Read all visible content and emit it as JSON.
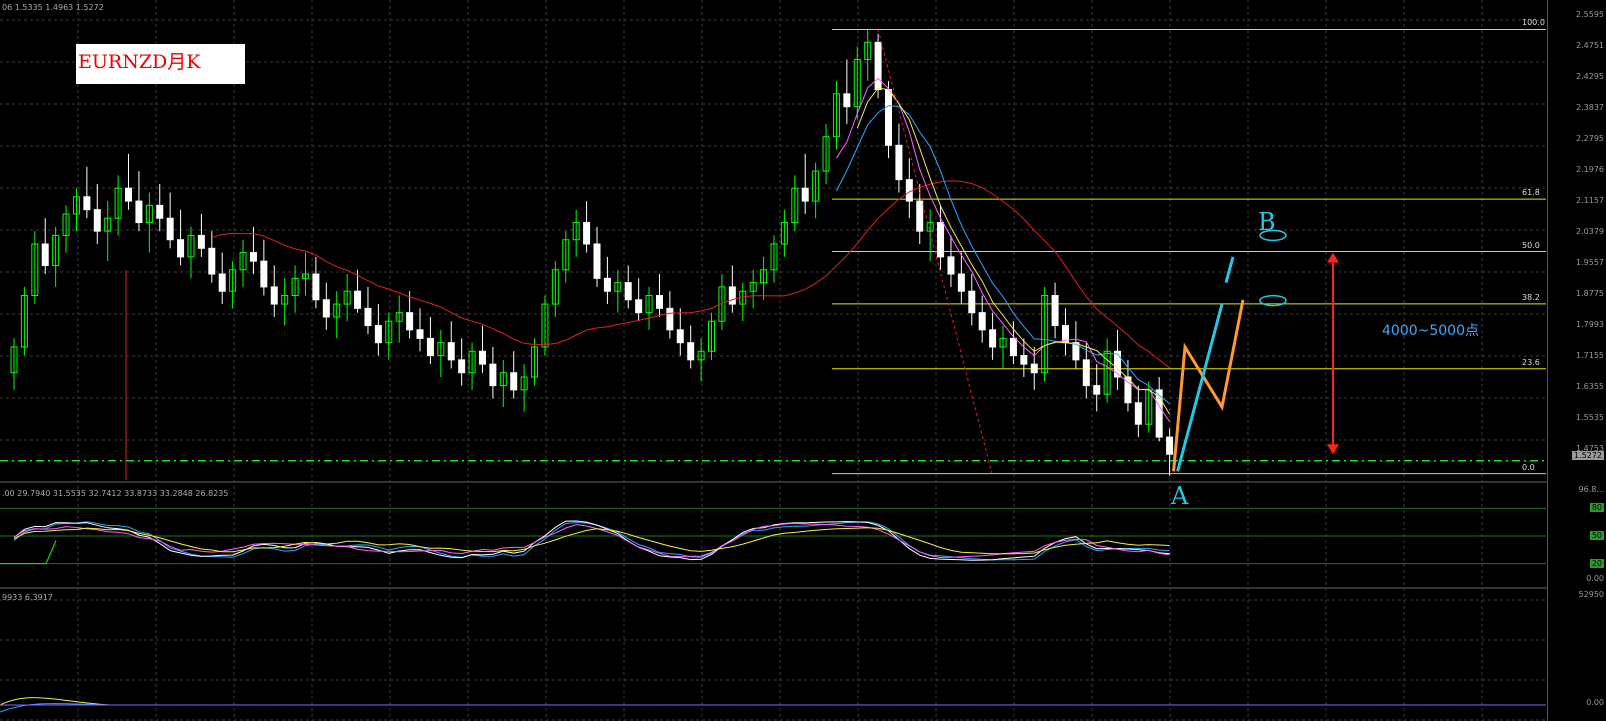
{
  "title": "EURNZD月K",
  "header_info": {
    "main": "06 1.5335 1.4963 1.5272",
    "stoch": ".00 29.7940 31.5535 32.7412 33.8733 33.2848 26.8235",
    "volume": "9933 6.3917"
  },
  "annotations": {
    "point_a": "A",
    "point_b": "B",
    "range_text": "4000~5000点"
  },
  "fib_levels": [
    {
      "label": "100.0",
      "value": 100.0
    },
    {
      "label": "61.8",
      "value": 61.8
    },
    {
      "label": "50.0",
      "value": 50.0
    },
    {
      "label": "38.2",
      "value": 38.2
    },
    {
      "label": "23.6",
      "value": 23.6
    },
    {
      "label": "0.0",
      "value": 0.0
    }
  ],
  "price_axis_labels": [
    "2.5595",
    "2.4751",
    "2.4295",
    "2.3837",
    "2.2795",
    "2.1976",
    "2.1157",
    "2.0379",
    "1.9557",
    "1.8775",
    "1.7993",
    "1.7155",
    "1.6355",
    "1.5535",
    "1.4753"
  ],
  "current_price": "1.5272",
  "oscillator_axis_labels": [
    "96.8...",
    "80",
    "50",
    "20",
    "0.00"
  ],
  "oscillator_levels": [
    80,
    50,
    20
  ],
  "volume_axis_labels": [
    "52950",
    "0.00"
  ],
  "colors": {
    "bull": "#00ff00",
    "bear": "#ffffff",
    "fib_line": "#e6e600",
    "dashed_level": "#20e020",
    "ma_red": "#e02020",
    "ma_pink": "#ff60ff",
    "ma_blue": "#2aa8ff",
    "ma_yellow": "#f0f040",
    "projection_orange": "#ff9933",
    "projection_cyan": "#22c8e6",
    "arrow_red": "#ff2020"
  },
  "chart_data": {
    "type": "candlestick",
    "title": "EURNZD月K",
    "y_range": [
      1.47,
      2.57
    ],
    "fib_high": 2.52,
    "fib_low": 1.485,
    "dashed_level_price": 1.515,
    "candles": [
      [
        1.72,
        1.8,
        1.68,
        1.78
      ],
      [
        1.78,
        1.92,
        1.76,
        1.9
      ],
      [
        1.9,
        2.05,
        1.88,
        2.02
      ],
      [
        2.02,
        2.08,
        1.95,
        1.97
      ],
      [
        1.97,
        2.06,
        1.92,
        2.04
      ],
      [
        2.04,
        2.11,
        2.0,
        2.09
      ],
      [
        2.09,
        2.15,
        2.05,
        2.13
      ],
      [
        2.13,
        2.2,
        2.08,
        2.1
      ],
      [
        2.1,
        2.16,
        2.02,
        2.05
      ],
      [
        2.05,
        2.12,
        1.98,
        2.08
      ],
      [
        2.08,
        2.18,
        2.04,
        2.15
      ],
      [
        2.15,
        2.23,
        2.1,
        2.12
      ],
      [
        2.12,
        2.19,
        2.05,
        2.07
      ],
      [
        2.07,
        2.14,
        2.0,
        2.11
      ],
      [
        2.11,
        2.16,
        2.05,
        2.08
      ],
      [
        2.08,
        2.14,
        2.01,
        2.03
      ],
      [
        2.03,
        2.1,
        1.97,
        1.99
      ],
      [
        1.99,
        2.06,
        1.94,
        2.04
      ],
      [
        2.04,
        2.09,
        1.99,
        2.01
      ],
      [
        2.01,
        2.05,
        1.93,
        1.95
      ],
      [
        1.95,
        2.0,
        1.88,
        1.91
      ],
      [
        1.91,
        1.98,
        1.87,
        1.96
      ],
      [
        1.96,
        2.03,
        1.92,
        2.0
      ],
      [
        2.0,
        2.06,
        1.95,
        1.98
      ],
      [
        1.98,
        2.03,
        1.9,
        1.92
      ],
      [
        1.92,
        1.97,
        1.85,
        1.88
      ],
      [
        1.88,
        1.94,
        1.83,
        1.9
      ],
      [
        1.9,
        1.97,
        1.86,
        1.94
      ],
      [
        1.94,
        2.0,
        1.9,
        1.95
      ],
      [
        1.95,
        1.99,
        1.87,
        1.89
      ],
      [
        1.89,
        1.93,
        1.82,
        1.85
      ],
      [
        1.85,
        1.91,
        1.8,
        1.88
      ],
      [
        1.88,
        1.95,
        1.84,
        1.91
      ],
      [
        1.91,
        1.96,
        1.86,
        1.87
      ],
      [
        1.87,
        1.92,
        1.81,
        1.83
      ],
      [
        1.83,
        1.88,
        1.76,
        1.79
      ],
      [
        1.79,
        1.86,
        1.75,
        1.84
      ],
      [
        1.84,
        1.9,
        1.79,
        1.86
      ],
      [
        1.86,
        1.91,
        1.8,
        1.82
      ],
      [
        1.82,
        1.87,
        1.77,
        1.8
      ],
      [
        1.8,
        1.85,
        1.74,
        1.76
      ],
      [
        1.76,
        1.82,
        1.71,
        1.79
      ],
      [
        1.79,
        1.84,
        1.73,
        1.75
      ],
      [
        1.75,
        1.8,
        1.69,
        1.72
      ],
      [
        1.72,
        1.79,
        1.68,
        1.77
      ],
      [
        1.77,
        1.83,
        1.72,
        1.74
      ],
      [
        1.74,
        1.78,
        1.66,
        1.69
      ],
      [
        1.69,
        1.75,
        1.64,
        1.72
      ],
      [
        1.72,
        1.77,
        1.66,
        1.68
      ],
      [
        1.68,
        1.74,
        1.63,
        1.71
      ],
      [
        1.71,
        1.8,
        1.69,
        1.78
      ],
      [
        1.78,
        1.9,
        1.76,
        1.88
      ],
      [
        1.88,
        1.98,
        1.85,
        1.96
      ],
      [
        1.96,
        2.05,
        1.93,
        2.03
      ],
      [
        2.03,
        2.1,
        1.99,
        2.07
      ],
      [
        2.07,
        2.12,
        2.0,
        2.02
      ],
      [
        2.02,
        2.06,
        1.92,
        1.94
      ],
      [
        1.94,
        1.99,
        1.88,
        1.91
      ],
      [
        1.91,
        1.96,
        1.86,
        1.93
      ],
      [
        1.93,
        1.97,
        1.87,
        1.89
      ],
      [
        1.89,
        1.94,
        1.84,
        1.86
      ],
      [
        1.86,
        1.92,
        1.82,
        1.9
      ],
      [
        1.9,
        1.95,
        1.85,
        1.87
      ],
      [
        1.87,
        1.91,
        1.8,
        1.82
      ],
      [
        1.82,
        1.87,
        1.76,
        1.79
      ],
      [
        1.79,
        1.83,
        1.73,
        1.75
      ],
      [
        1.75,
        1.8,
        1.7,
        1.77
      ],
      [
        1.77,
        1.86,
        1.75,
        1.84
      ],
      [
        1.84,
        1.95,
        1.82,
        1.92
      ],
      [
        1.92,
        1.97,
        1.86,
        1.88
      ],
      [
        1.88,
        1.93,
        1.84,
        1.91
      ],
      [
        1.91,
        1.96,
        1.87,
        1.93
      ],
      [
        1.93,
        1.99,
        1.89,
        1.96
      ],
      [
        1.96,
        2.04,
        1.93,
        2.02
      ],
      [
        2.02,
        2.1,
        1.99,
        2.07
      ],
      [
        2.07,
        2.18,
        2.05,
        2.15
      ],
      [
        2.15,
        2.23,
        2.09,
        2.12
      ],
      [
        2.12,
        2.21,
        2.08,
        2.19
      ],
      [
        2.19,
        2.3,
        2.16,
        2.27
      ],
      [
        2.27,
        2.4,
        2.24,
        2.37
      ],
      [
        2.37,
        2.45,
        2.3,
        2.34
      ],
      [
        2.34,
        2.48,
        2.31,
        2.45
      ],
      [
        2.45,
        2.52,
        2.4,
        2.49
      ],
      [
        2.49,
        2.51,
        2.36,
        2.38
      ],
      [
        2.38,
        2.4,
        2.22,
        2.25
      ],
      [
        2.25,
        2.3,
        2.14,
        2.17
      ],
      [
        2.17,
        2.22,
        2.08,
        2.12
      ],
      [
        2.12,
        2.16,
        2.02,
        2.05
      ],
      [
        2.05,
        2.1,
        1.98,
        2.07
      ],
      [
        2.07,
        2.11,
        1.96,
        1.99
      ],
      [
        1.99,
        2.04,
        1.92,
        1.95
      ],
      [
        1.95,
        2.0,
        1.88,
        1.91
      ],
      [
        1.91,
        1.95,
        1.83,
        1.86
      ],
      [
        1.86,
        1.9,
        1.79,
        1.82
      ],
      [
        1.82,
        1.86,
        1.75,
        1.78
      ],
      [
        1.78,
        1.83,
        1.73,
        1.8
      ],
      [
        1.8,
        1.84,
        1.74,
        1.76
      ],
      [
        1.76,
        1.8,
        1.71,
        1.74
      ],
      [
        1.74,
        1.78,
        1.68,
        1.72
      ],
      [
        1.72,
        1.92,
        1.7,
        1.9
      ],
      [
        1.9,
        1.93,
        1.8,
        1.83
      ],
      [
        1.83,
        1.87,
        1.76,
        1.79
      ],
      [
        1.79,
        1.84,
        1.73,
        1.75
      ],
      [
        1.75,
        1.79,
        1.66,
        1.69
      ],
      [
        1.69,
        1.74,
        1.63,
        1.67
      ],
      [
        1.67,
        1.8,
        1.65,
        1.77
      ],
      [
        1.77,
        1.82,
        1.68,
        1.71
      ],
      [
        1.71,
        1.75,
        1.63,
        1.65
      ],
      [
        1.65,
        1.69,
        1.57,
        1.6
      ],
      [
        1.6,
        1.7,
        1.58,
        1.68
      ],
      [
        1.68,
        1.71,
        1.56,
        1.57
      ],
      [
        1.57,
        1.59,
        1.48,
        1.53
      ]
    ]
  }
}
